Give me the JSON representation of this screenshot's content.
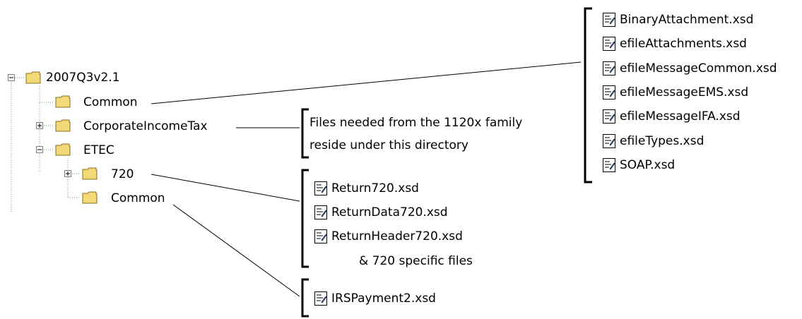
{
  "tree": {
    "root": "2007Q3v2.1",
    "root_common": "Common",
    "corporate": "CorporateIncomeTax",
    "etec": "ETEC",
    "etec_720": "720",
    "etec_common": "Common"
  },
  "groups": {
    "common_files": [
      "BinaryAttachment.xsd",
      "efileAttachments.xsd",
      "efileMessageCommon.xsd",
      "efileMessageEMS.xsd",
      "efileMessageIFA.xsd",
      "efileTypes.xsd",
      "SOAP.xsd"
    ],
    "corporate_note": [
      "Files needed from the 1120x family",
      "reside under this directory"
    ],
    "f720_files": [
      "Return720.xsd",
      "ReturnData720.xsd",
      "ReturnHeader720.xsd"
    ],
    "f720_extra": "& 720 specific files",
    "etec_common_files": [
      "IRSPayment2.xsd"
    ]
  },
  "colors": {
    "folder_fill": "#f3d978",
    "folder_stroke": "#8a6d1e",
    "tree_line": "#808080",
    "bracket": "#000000"
  },
  "icons": {
    "folder": "folder-icon",
    "file": "xsd-file-icon",
    "expand": "plus-box-icon",
    "collapse": "minus-box-icon"
  }
}
